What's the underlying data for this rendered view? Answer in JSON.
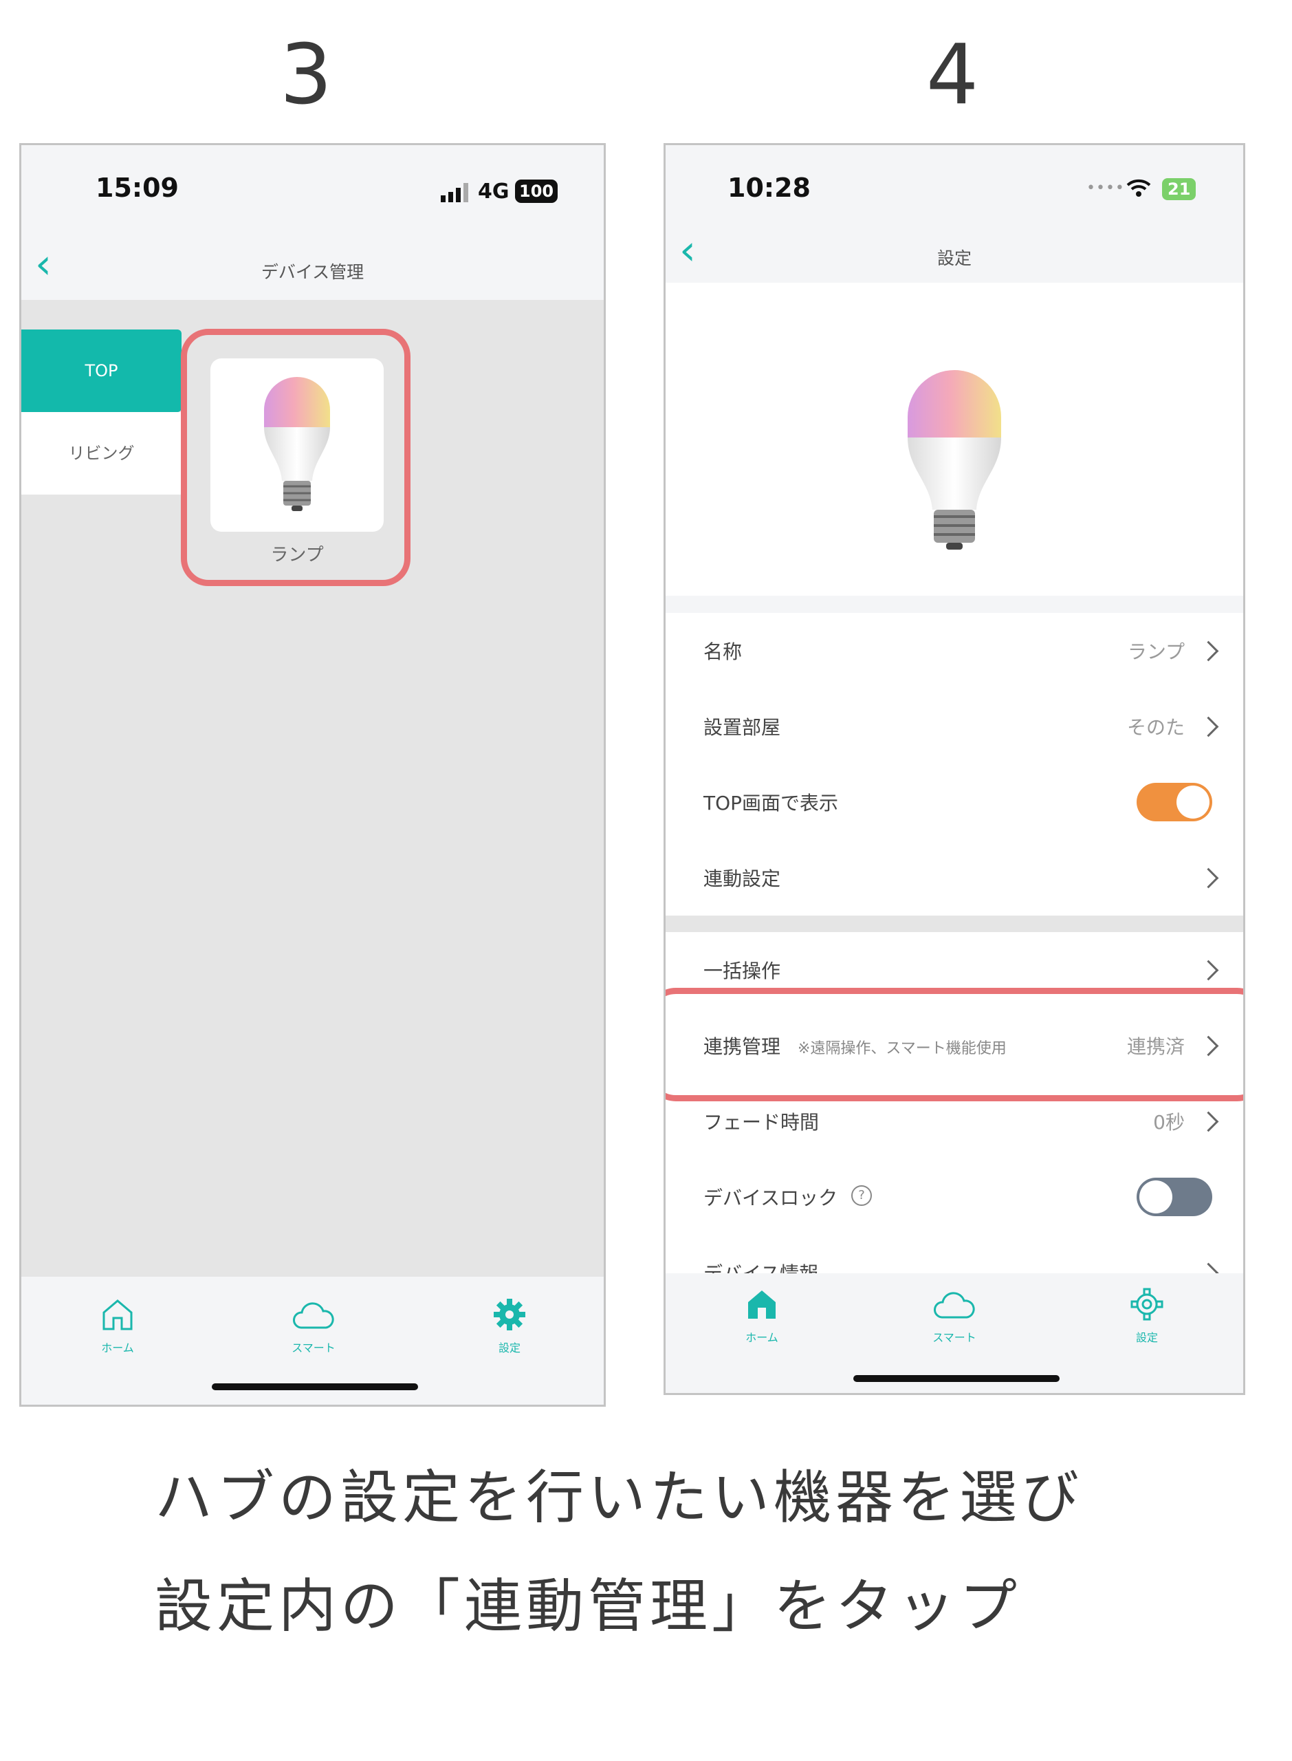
{
  "steps": {
    "left": "3",
    "right": "4"
  },
  "left_phone": {
    "time": "15:09",
    "network": "4G",
    "battery": "100",
    "nav_title": "デバイス管理",
    "sidebar": [
      {
        "label": "TOP",
        "active": true
      },
      {
        "label": "リビング",
        "active": false
      }
    ],
    "device": {
      "name": "ランプ"
    },
    "tabs": [
      {
        "label": "ホーム",
        "icon": "home-icon"
      },
      {
        "label": "スマート",
        "icon": "cloud-icon"
      },
      {
        "label": "設定",
        "icon": "gear-icon"
      }
    ]
  },
  "right_phone": {
    "time": "10:28",
    "battery": "21",
    "nav_title": "設定",
    "rows_group1": [
      {
        "label": "名称",
        "value": "ランプ"
      },
      {
        "label": "設置部屋",
        "value": "そのた"
      },
      {
        "label": "TOP画面で表示",
        "toggle": true
      },
      {
        "label": "連動設定",
        "value": ""
      }
    ],
    "rows_group2": [
      {
        "label": "一括操作",
        "value": ""
      },
      {
        "label": "連携管理",
        "note": "※遠隔操作、スマート機能使用",
        "value": "連携済"
      },
      {
        "label": "フェード時間",
        "value": "0秒"
      },
      {
        "label": "デバイスロック",
        "help": "?",
        "toggle": false
      },
      {
        "label": "デバイス情報",
        "value": ""
      }
    ],
    "tabs": [
      {
        "label": "ホーム",
        "icon": "home-icon"
      },
      {
        "label": "スマート",
        "icon": "cloud-icon"
      },
      {
        "label": "設定",
        "icon": "gear-icon"
      }
    ]
  },
  "caption": {
    "line1": "ハブの設定を行いたい機器を選び",
    "line2": "設定内の「連動管理」をタップ"
  },
  "colors": {
    "accent": "#1ab7ac",
    "highlight": "#e87376",
    "toggle_on": "#f0913f",
    "toggle_off": "#6e7b8b"
  }
}
